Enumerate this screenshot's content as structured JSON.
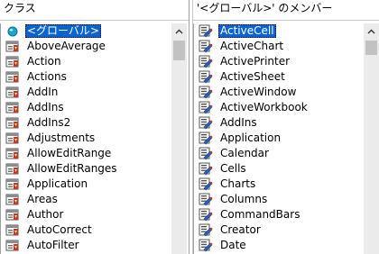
{
  "left_pane": {
    "header": "クラス",
    "items": [
      {
        "label": "<グローバル>",
        "icon": "globe-icon",
        "selected": true
      },
      {
        "label": "AboveAverage",
        "icon": "class-module-icon"
      },
      {
        "label": "Action",
        "icon": "class-module-icon"
      },
      {
        "label": "Actions",
        "icon": "class-module-icon"
      },
      {
        "label": "AddIn",
        "icon": "class-module-icon"
      },
      {
        "label": "AddIns",
        "icon": "class-module-icon"
      },
      {
        "label": "AddIns2",
        "icon": "class-module-icon"
      },
      {
        "label": "Adjustments",
        "icon": "class-module-icon"
      },
      {
        "label": "AllowEditRange",
        "icon": "class-module-icon"
      },
      {
        "label": "AllowEditRanges",
        "icon": "class-module-icon"
      },
      {
        "label": "Application",
        "icon": "class-module-icon"
      },
      {
        "label": "Areas",
        "icon": "class-module-icon"
      },
      {
        "label": "Author",
        "icon": "class-module-icon"
      },
      {
        "label": "AutoCorrect",
        "icon": "class-module-icon"
      },
      {
        "label": "AutoFilter",
        "icon": "class-module-icon"
      }
    ]
  },
  "right_pane": {
    "header": "'<グローバル>' のメンバー",
    "items": [
      {
        "label": "ActiveCell",
        "icon": "property-icon",
        "selected": true
      },
      {
        "label": "ActiveChart",
        "icon": "property-icon"
      },
      {
        "label": "ActivePrinter",
        "icon": "property-icon"
      },
      {
        "label": "ActiveSheet",
        "icon": "property-icon"
      },
      {
        "label": "ActiveWindow",
        "icon": "property-icon"
      },
      {
        "label": "ActiveWorkbook",
        "icon": "property-icon"
      },
      {
        "label": "AddIns",
        "icon": "property-icon"
      },
      {
        "label": "Application",
        "icon": "property-icon"
      },
      {
        "label": "Calendar",
        "icon": "property-icon"
      },
      {
        "label": "Cells",
        "icon": "property-icon"
      },
      {
        "label": "Charts",
        "icon": "property-icon"
      },
      {
        "label": "Columns",
        "icon": "property-icon"
      },
      {
        "label": "CommandBars",
        "icon": "property-icon"
      },
      {
        "label": "Creator",
        "icon": "property-icon"
      },
      {
        "label": "Date",
        "icon": "property-icon"
      }
    ]
  },
  "colors": {
    "selection": "#0a64d0",
    "scrollbar_track": "#ebebeb",
    "scrollbar_thumb": "#c2c2c2"
  }
}
